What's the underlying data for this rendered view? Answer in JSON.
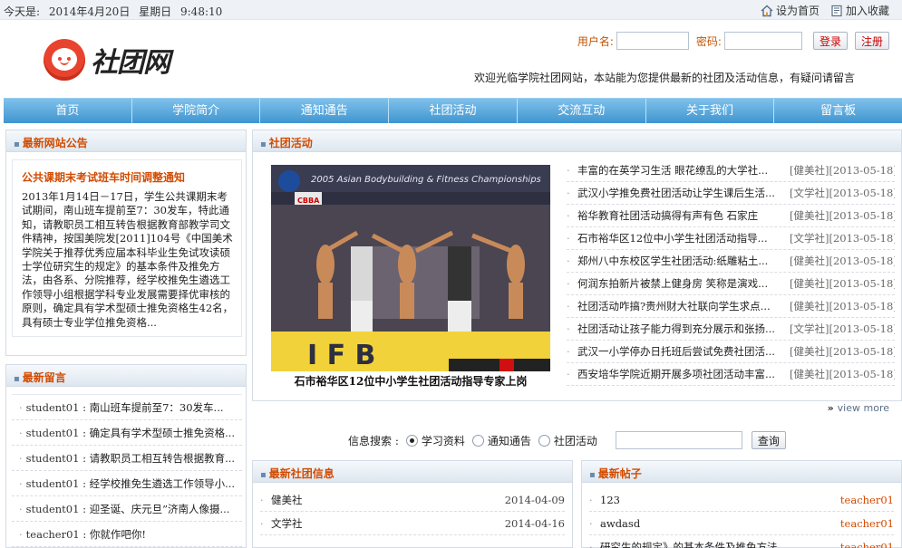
{
  "topbar": {
    "date_label": "今天是:",
    "date": "2014年4月20日",
    "weekday": "星期日",
    "time": "9:48:10",
    "set_home": "设为首页",
    "add_fav": "加入收藏"
  },
  "logo": {
    "text": "社团网"
  },
  "login": {
    "username_label": "用户名:",
    "password_label": "密码:",
    "username_value": "",
    "password_value": "",
    "login_button": "登录",
    "register_button": "注册"
  },
  "welcome": "欢迎光临学院社团网站，本站能为您提供最新的社团及活动信息，有疑问请留言",
  "nav": [
    "首页",
    "学院简介",
    "通知通告",
    "社团活动",
    "交流互动",
    "关于我们",
    "留言板"
  ],
  "notice": {
    "header": "最新网站公告",
    "title": "公共课期末考试班车时间调整通知",
    "body": "2013年1月14日－17日，学生公共课期末考试期间，南山班车提前至7：30发车，特此通知，请教职员工相互转告根据教育部教学司文件精神，按国美院发[2011]104号《中国美术学院关于推荐优秀应届本科毕业生免试攻读硕士学位研究生的规定》的基本条件及推免方法，由各系、分院推荐，经学校推免生遴选工作领导小组根据学科专业发展需要择优审核的原则，确定具有学术型硕士推免资格生42名，具有硕士专业学位推免资格..."
  },
  "messages": {
    "header": "最新留言",
    "items": [
      {
        "user": "student01",
        "text": "南山班车提前至7：30发车..."
      },
      {
        "user": "student01",
        "text": "确定具有学术型硕士推免资格..."
      },
      {
        "user": "student01",
        "text": "请教职员工相互转告根据教育..."
      },
      {
        "user": "student01",
        "text": "经学校推免生遴选工作领导小..."
      },
      {
        "user": "student01",
        "text": "迎圣诞、庆元旦”济南人像摄..."
      },
      {
        "user": "teacher01",
        "text": "你就作吧你!"
      }
    ]
  },
  "activities": {
    "header": "社团活动",
    "photo_banner": "2005 Asian Bodybuilding & Fitness Championships",
    "photo_logo": "CBBA",
    "photo_letters": "I F B",
    "caption": "石市裕华区12位中小学生社团活动指导专家上岗",
    "items": [
      {
        "title": "丰富的在英学习生活 眼花缭乱的大学社...",
        "club": "[健美社]",
        "date": "[2013-05-18]"
      },
      {
        "title": "武汉小学推免费社团活动让学生课后生活...",
        "club": "[文学社]",
        "date": "[2013-05-18]"
      },
      {
        "title": "裕华教育社团活动搞得有声有色 石家庄",
        "club": "[健美社]",
        "date": "[2013-05-18]"
      },
      {
        "title": "石市裕华区12位中小学生社团活动指导...",
        "club": "[文学社]",
        "date": "[2013-05-18]"
      },
      {
        "title": "郑州八中东校区学生社团活动:纸雕粘土...",
        "club": "[健美社]",
        "date": "[2013-05-18]"
      },
      {
        "title": "何润东拍新片被禁上健身房 笑称是演戏...",
        "club": "[健美社]",
        "date": "[2013-05-18]"
      },
      {
        "title": "社团活动咋搞?贵州财大社联向学生求点...",
        "club": "[健美社]",
        "date": "[2013-05-18]"
      },
      {
        "title": "社团活动让孩子能力得到充分展示和张扬...",
        "club": "[文学社]",
        "date": "[2013-05-18]"
      },
      {
        "title": "武汉一小学停办日托班后尝试免费社团活...",
        "club": "[健美社]",
        "date": "[2013-05-18]"
      },
      {
        "title": "西安培华学院近期开展多项社团活动丰富...",
        "club": "[健美社]",
        "date": "[2013-05-18]"
      }
    ],
    "view_more": "view more"
  },
  "search": {
    "label": "信息搜索 :",
    "options": [
      "学习资料",
      "通知通告",
      "社团活动"
    ],
    "selected": "学习资料",
    "input_value": "",
    "button": "查询"
  },
  "clubs": {
    "header": "最新社团信息",
    "items": [
      {
        "name": "健美社",
        "date": "2014-04-09"
      },
      {
        "name": "文学社",
        "date": "2014-04-16"
      }
    ]
  },
  "posts": {
    "header": "最新帖子",
    "items": [
      {
        "title": "123",
        "user": "teacher01"
      },
      {
        "title": "awdasd",
        "user": "teacher01"
      },
      {
        "title": "研究生的规定》的基本条件及推免方法，...",
        "user": "teacher01"
      }
    ]
  },
  "colors": {
    "accent": "#d24b00",
    "nav_top": "#7fc1ec",
    "nav_bottom": "#3f95cf",
    "logo_red": "#e8432e"
  }
}
